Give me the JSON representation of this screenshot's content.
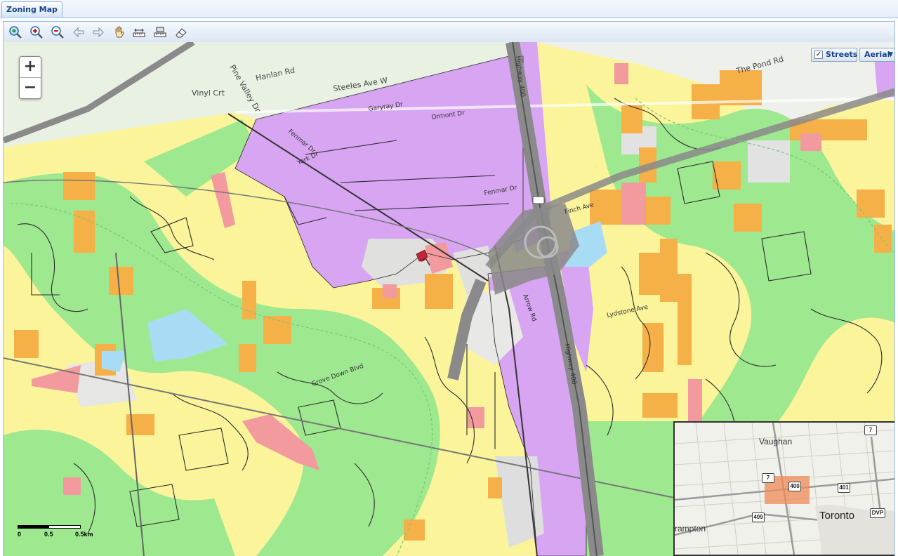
{
  "tab": {
    "label": "Zoning Map"
  },
  "toolbar": {
    "buttons": [
      {
        "name": "zoom-extent-icon"
      },
      {
        "name": "zoom-in-icon"
      },
      {
        "name": "zoom-out-icon"
      },
      {
        "name": "back-arrow-icon"
      },
      {
        "name": "forward-arrow-icon"
      },
      {
        "name": "pan-hand-icon"
      },
      {
        "name": "measure-distance-icon"
      },
      {
        "name": "measure-area-icon"
      },
      {
        "name": "eraser-icon"
      }
    ]
  },
  "map": {
    "zoom_in": "+",
    "zoom_out": "−",
    "streets_label": "Streets",
    "streets_checked": "✓",
    "aerial_label": "Aerial",
    "aerial_arrow": "▼",
    "scale": {
      "a": "0",
      "b": "0.5",
      "c": "0.5km"
    },
    "roads": {
      "steeles": "Steeles Ave W",
      "hanlan": "Hanlan Rd",
      "vinyl": "Vinyl Crt",
      "pine_valley": "Pine Valley Dr",
      "garyray": "Garyray Dr",
      "ormont": "Ormont Dr",
      "fenmar1": "Fenmar Dr",
      "fenmar2": "Fenmar Dr",
      "york": "York Dr",
      "highway400a": "Highway 400",
      "highway400b": "Highway 400",
      "pond": "The Pond Rd",
      "finch": "Finch Ave",
      "grove": "Grove Down Blvd",
      "arrow": "Arrow Rd",
      "lydstone": "Lydstone Ave"
    },
    "overview": {
      "vaughan": "Vaughan",
      "toronto": "Toronto",
      "brampton": "rampton",
      "shields": [
        "7",
        "7",
        "400",
        "401",
        "409",
        "DVP"
      ]
    }
  },
  "colors": {
    "residential": "#fbf49a",
    "open_space": "#9ee890",
    "employment": "#d7a5f2",
    "commercial": "#f6b048",
    "institutional": "#f39a9e",
    "water": "#a8dcf5",
    "undeveloped": "#dadada",
    "highway": "#9a9a9a"
  }
}
